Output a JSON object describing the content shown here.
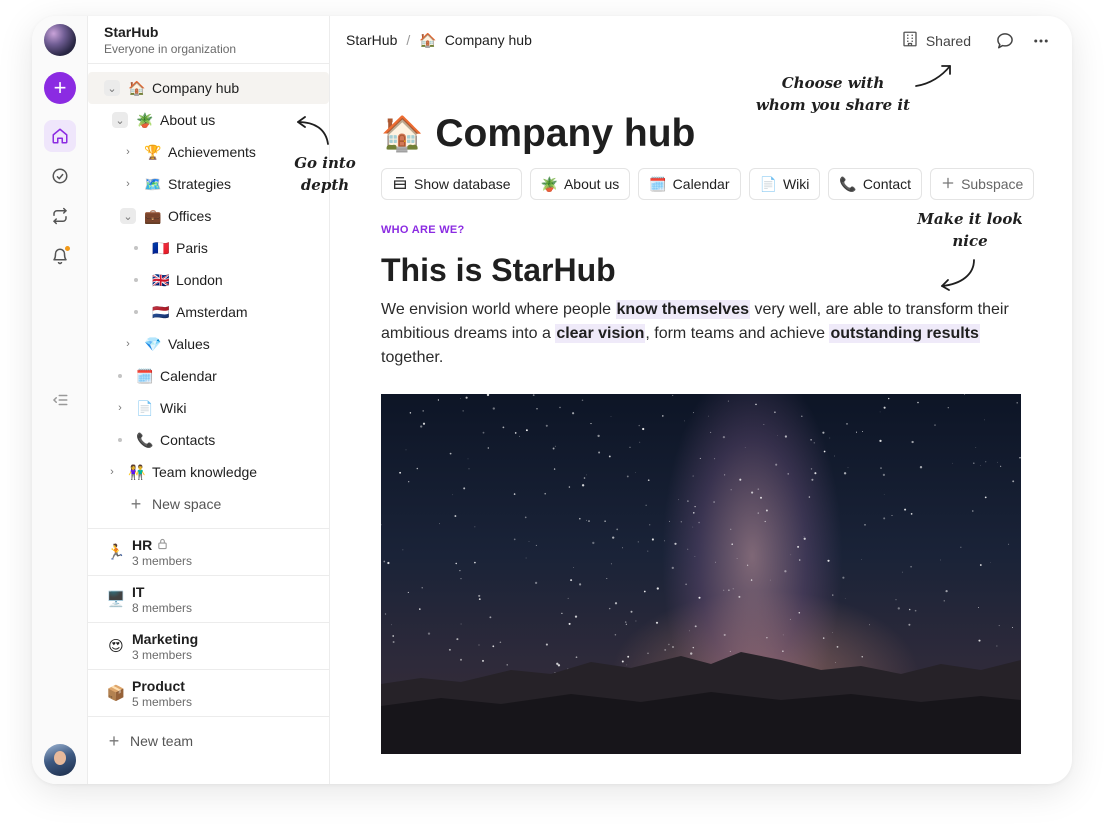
{
  "org": {
    "name": "StarHub",
    "subtitle": "Everyone in organization"
  },
  "rail": {
    "icons": [
      "home-icon",
      "check-circle-icon",
      "repeat-icon",
      "bell-icon",
      "collapse-list-icon"
    ],
    "accent": "#8b2be2",
    "notification_color": "#f29a1a"
  },
  "tree": [
    {
      "label": "Company hub",
      "emoji": "🏠",
      "state": "open"
    },
    {
      "label": "About us",
      "emoji": "🪴",
      "state": "open"
    },
    {
      "label": "Achievements",
      "emoji": "🏆",
      "state": "closed"
    },
    {
      "label": "Strategies",
      "emoji": "🗺️",
      "state": "closed"
    },
    {
      "label": "Offices",
      "emoji": "💼",
      "state": "open"
    },
    {
      "label": "Paris",
      "emoji": "🇫🇷",
      "state": "leaf"
    },
    {
      "label": "London",
      "emoji": "🇬🇧",
      "state": "leaf"
    },
    {
      "label": "Amsterdam",
      "emoji": "🇳🇱",
      "state": "leaf"
    },
    {
      "label": "Values",
      "emoji": "💎",
      "state": "closed"
    },
    {
      "label": "Calendar",
      "emoji": "🗓️",
      "state": "leaf"
    },
    {
      "label": "Wiki",
      "emoji": "📄",
      "state": "closed"
    },
    {
      "label": "Contacts",
      "emoji": "📞",
      "state": "leaf"
    },
    {
      "label": "Team knowledge",
      "emoji": "👫",
      "state": "closed"
    },
    {
      "label": "New space"
    }
  ],
  "teams": [
    {
      "name": "HR",
      "emoji": "🏃",
      "members": "3 members",
      "locked": true
    },
    {
      "name": "IT",
      "emoji": "🖥️",
      "members": "8 members",
      "locked": false
    },
    {
      "name": "Marketing",
      "emoji": "😍",
      "members": "3 members",
      "locked": false
    },
    {
      "name": "Product",
      "emoji": "📦",
      "members": "5 members",
      "locked": false
    }
  ],
  "new_team_label": "New team",
  "breadcrumb": {
    "root": "StarHub",
    "separator": "/",
    "current_emoji": "🏠",
    "current": "Company hub"
  },
  "topbar": {
    "shared_label": "Shared"
  },
  "page": {
    "title_emoji": "🏠",
    "title": "Company hub",
    "chips": [
      {
        "label": "Show database",
        "icon": "database-icon"
      },
      {
        "label": "About us",
        "emoji": "🪴"
      },
      {
        "label": "Calendar",
        "emoji": "🗓️"
      },
      {
        "label": "Wiki",
        "emoji": "📄"
      },
      {
        "label": "Contact",
        "emoji": "📞"
      },
      {
        "label": "Subspace",
        "icon": "plus-icon"
      }
    ],
    "eyebrow": "WHO ARE WE?",
    "section_title": "This is StarHub",
    "paragraph": {
      "t1": "We envision world where people ",
      "h1": "know themselves",
      "t2": " very well, are able to transform their ambitious dreams into a ",
      "h2": "clear vision",
      "t3": ", form teams and achieve ",
      "h3": "outstanding results",
      "t4": " together."
    }
  },
  "annotations": {
    "depth": [
      "Go into",
      "depth"
    ],
    "share": [
      "Choose with",
      "whom you share it"
    ],
    "nice": [
      "Make it look",
      "nice"
    ]
  }
}
